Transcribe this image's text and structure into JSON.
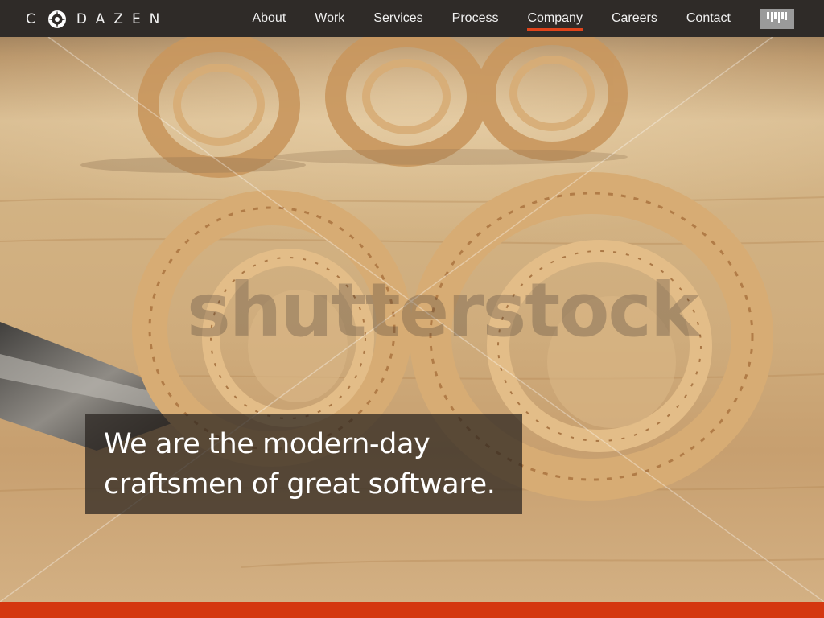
{
  "brand": {
    "name_left": "C",
    "name_right": "DAZEN",
    "logo_icon": "compass-logo-icon"
  },
  "nav": {
    "items": [
      {
        "label": "About"
      },
      {
        "label": "Work"
      },
      {
        "label": "Services"
      },
      {
        "label": "Process"
      },
      {
        "label": "Company",
        "active": true
      },
      {
        "label": "Careers"
      },
      {
        "label": "Contact"
      }
    ],
    "menu_icon": "barcode-menu-icon"
  },
  "hero": {
    "headline_line1": "We are the modern-day",
    "headline_line2": "craftsmen of great software.",
    "watermark": "shutterstock"
  },
  "colors": {
    "nav_background": "#2f2b28",
    "accent": "#e0441b",
    "footer_bar": "#d4370f"
  }
}
